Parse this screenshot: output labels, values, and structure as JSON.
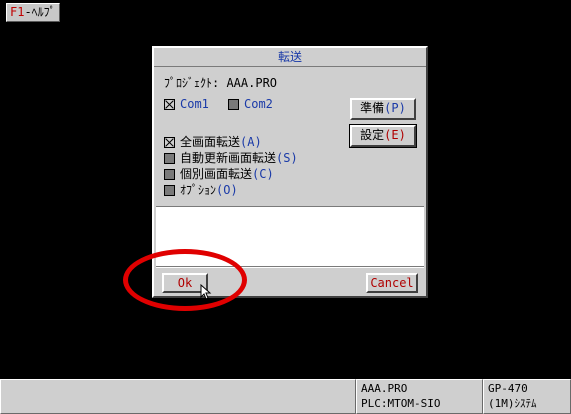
{
  "help_key": {
    "key": "F1",
    "label": "-ﾍﾙﾌﾟ"
  },
  "dialog": {
    "title": "転送",
    "project_label": "ﾌﾟﾛｼﾞｪｸﾄ: AAA.PRO",
    "com1": {
      "label": "Com1",
      "checked": true
    },
    "com2": {
      "label": "Com2",
      "checked": false
    },
    "prepare_button": {
      "text": "準備",
      "accel": "(P)"
    },
    "settings_button": {
      "text": "設定",
      "accel": "(E)"
    },
    "options": [
      {
        "text": "全画面転送",
        "accel": "(A)",
        "checked": true
      },
      {
        "text": "自動更新画面転送",
        "accel": "(S)",
        "checked": false
      },
      {
        "text": "個別画面転送",
        "accel": "(C)",
        "checked": false
      },
      {
        "text": "ｵﾌﾟｼｮﾝ",
        "accel": "(O)",
        "checked": false
      }
    ],
    "ok_button": {
      "accel": "O",
      "rest": "k"
    },
    "cancel_button": {
      "label": "Cancel"
    }
  },
  "statusbar": {
    "project": "AAA.PRO",
    "plc": "PLC:MTOM-SIO",
    "model": "GP-470",
    "system": "(1M)ｼｽﾃﾑ"
  },
  "colors": {
    "background": "#000000",
    "dialog_face": "#cfcfcf",
    "accent_blue": "#1a3aa8",
    "accelerator_red": "#b00000",
    "annotation_red": "#e00000"
  }
}
